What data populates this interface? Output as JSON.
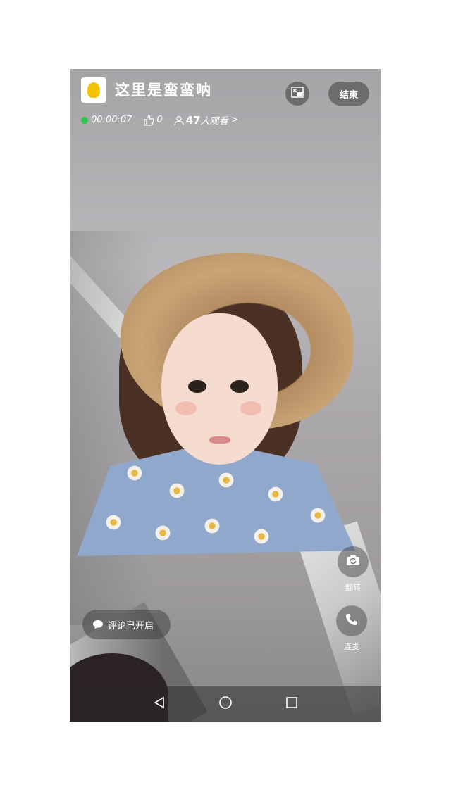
{
  "header": {
    "title": "这里是蛮蛮呐",
    "end_label": "结束"
  },
  "stats": {
    "duration": "00:00:07",
    "likes": "0",
    "viewers": "47",
    "viewers_suffix": "人观看",
    "chevron": ">"
  },
  "side_controls": {
    "flip_label": "翻转",
    "connect_label": "连麦"
  },
  "comment": {
    "label": "评论已开启"
  },
  "colors": {
    "live": "#2cc84a",
    "overlay": "rgba(60,60,60,0.5)"
  },
  "icons": [
    "pip-icon",
    "thumb-up-icon",
    "viewer-icon",
    "flip-camera-icon",
    "phone-icon",
    "comment-icon",
    "back-icon",
    "home-icon",
    "recent-apps-icon"
  ]
}
